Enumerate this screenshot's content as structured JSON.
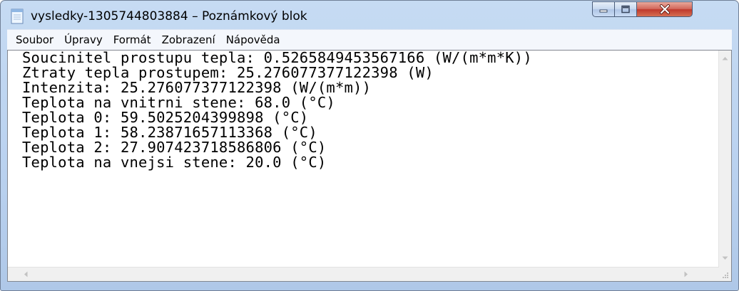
{
  "window": {
    "title": "vysledky-1305744803884 – Poznámkový blok"
  },
  "menu": [
    {
      "label": "Soubor"
    },
    {
      "label": "Úpravy"
    },
    {
      "label": "Formát"
    },
    {
      "label": "Zobrazení"
    },
    {
      "label": "Nápověda"
    }
  ],
  "editor": {
    "lines": [
      "Soucinitel prostupu tepla: 0.5265849453567166 (W/(m*m*K))",
      "Ztraty tepla prostupem: 25.276077377122398 (W)",
      "Intenzita: 25.276077377122398 (W/(m*m))",
      "Teplota na vnitrni stene: 68.0 (°C)",
      "Teplota 0: 59.5025204399898 (°C)",
      "Teplota 1: 58.23871657113368 (°C)",
      "Teplota 2: 27.907423718586806 (°C)",
      "Teplota na vnejsi stene: 20.0 (°C)"
    ]
  },
  "icons": {
    "app": "notepad-icon",
    "minimize": "minimize-icon",
    "maximize": "maximize-icon",
    "close": "close-icon"
  },
  "colors": {
    "frame": "#b9d1ef",
    "close_button": "#c0392b",
    "menubar": "#f4f7fc"
  }
}
